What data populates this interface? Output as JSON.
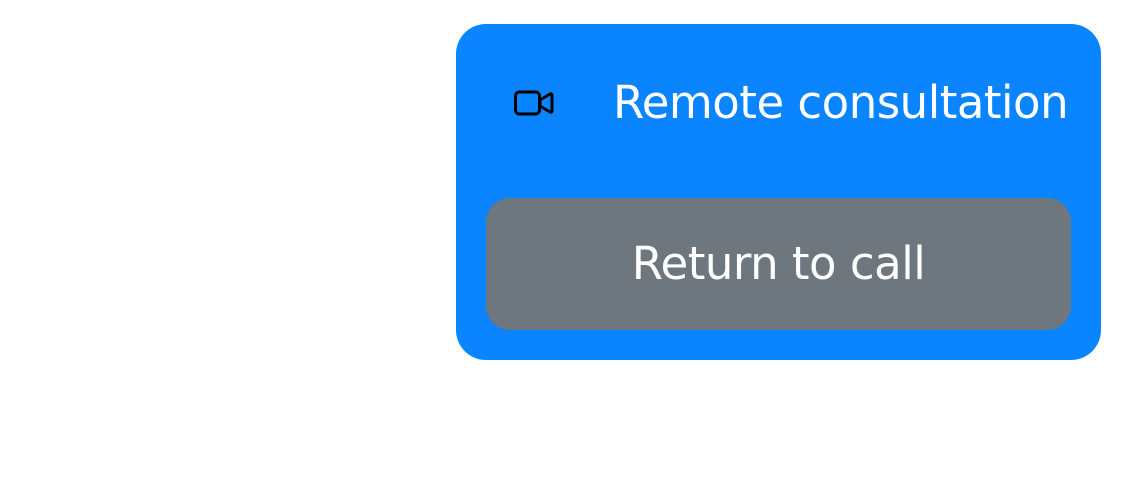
{
  "call_card": {
    "icon": "video-camera-icon",
    "title": "Remote consultation",
    "return_button_label": "Return to call"
  },
  "colors": {
    "card_background": "#0a84ff",
    "button_background": "#6f777e",
    "text": "#ffffff",
    "icon": "#000000"
  }
}
